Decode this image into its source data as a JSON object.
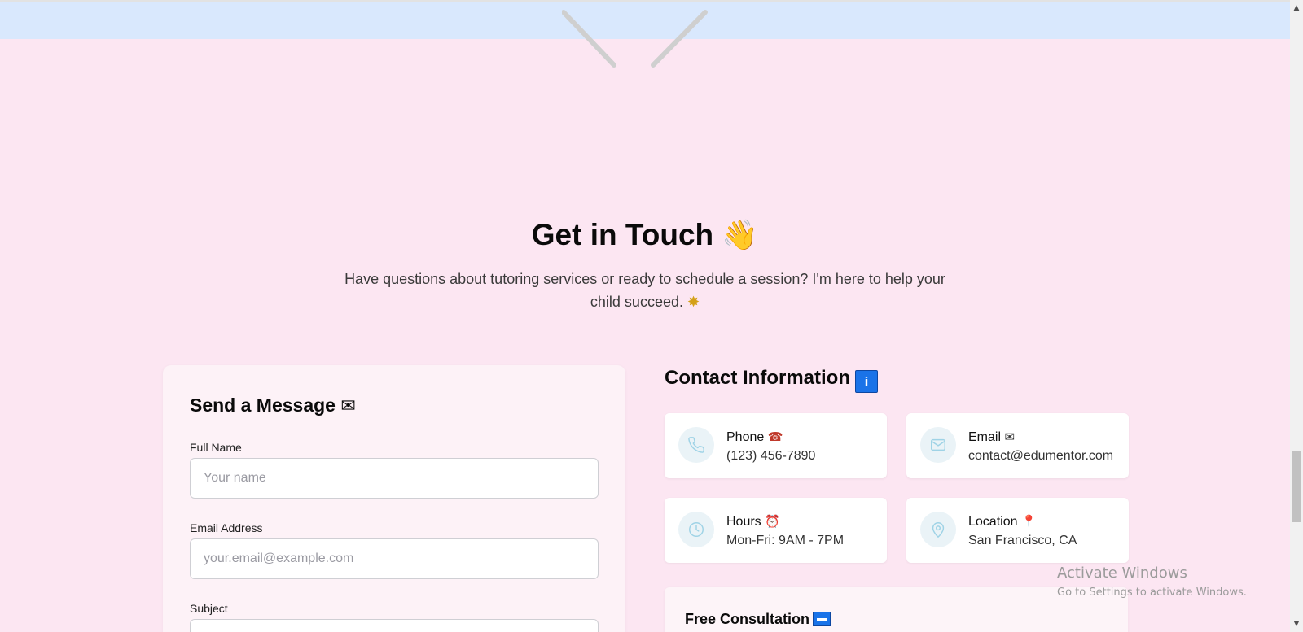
{
  "hero": {
    "title": "Get in Touch",
    "title_emoji": "👋",
    "subtitle": "Have questions about tutoring services or ready to schedule a session? I'm here to help your child succeed.",
    "subtitle_emoji": "✸"
  },
  "form": {
    "title": "Send a Message",
    "title_emoji": "✉",
    "fields": [
      {
        "label": "Full Name",
        "placeholder": "Your name"
      },
      {
        "label": "Email Address",
        "placeholder": "your.email@example.com"
      },
      {
        "label": "Subject",
        "placeholder": ""
      }
    ]
  },
  "contact": {
    "title": "Contact Information",
    "title_badge": "i",
    "items": [
      {
        "label": "Phone",
        "emoji": "☎",
        "value": "(123) 456-7890",
        "icon": "phone-icon"
      },
      {
        "label": "Email",
        "emoji": "✉",
        "value": "contact@edumentor.com",
        "icon": "mail-icon"
      },
      {
        "label": "Hours",
        "emoji": "⏰",
        "value": "Mon-Fri: 9AM - 7PM",
        "icon": "clock-icon"
      },
      {
        "label": "Location",
        "emoji": "📍",
        "value": "San Francisco, CA",
        "icon": "map-pin-icon"
      }
    ],
    "consultation_title": "Free Consultation"
  },
  "watermark": {
    "title": "Activate Windows",
    "subtitle": "Go to Settings to activate Windows."
  },
  "colors": {
    "page_bg": "#fce6f2",
    "top_band": "#d9e8fd",
    "accent_blue": "#1a73e8",
    "icon_stroke": "#9fd3e6"
  }
}
